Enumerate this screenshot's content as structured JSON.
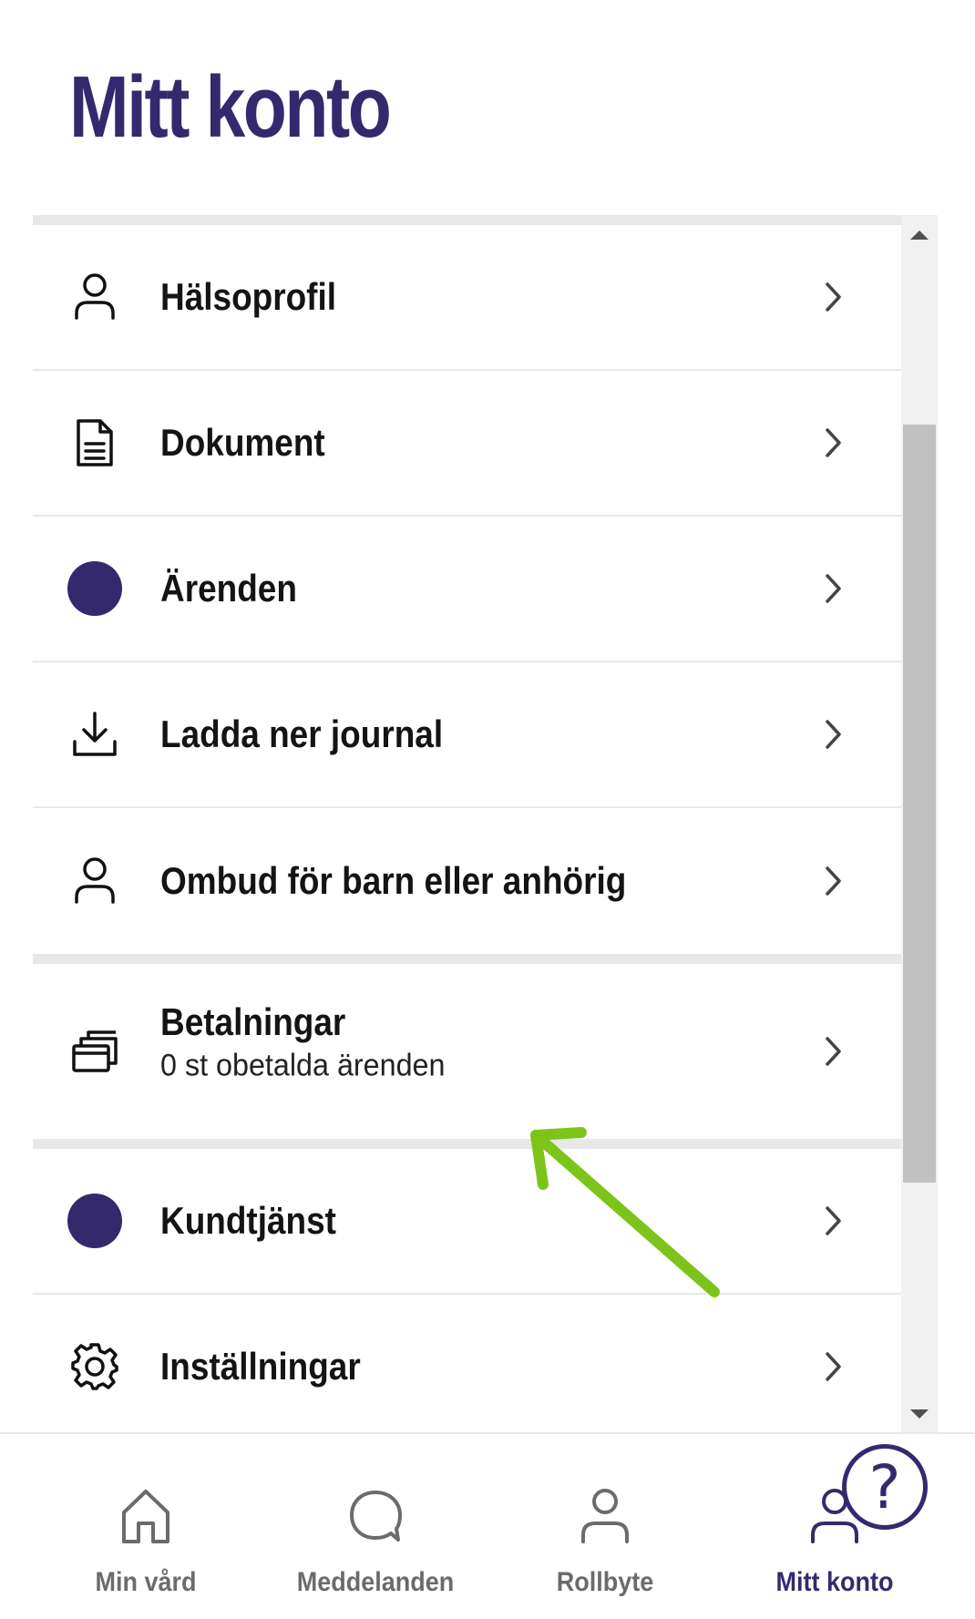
{
  "page": {
    "title": "Mitt konto"
  },
  "menu": {
    "items": [
      {
        "label": "Hälsoprofil",
        "icon": "person-icon"
      },
      {
        "label": "Dokument",
        "icon": "document-icon"
      },
      {
        "label": "Ärenden",
        "icon": "dot-icon"
      },
      {
        "label": "Ladda ner journal",
        "icon": "download-icon"
      },
      {
        "label": "Ombud för barn eller anhörig",
        "icon": "person-icon"
      },
      {
        "label": "Betalningar",
        "sublabel": "0 st obetalda ärenden",
        "icon": "cards-icon"
      },
      {
        "label": "Kundtjänst",
        "icon": "dot-icon"
      },
      {
        "label": "Inställningar",
        "icon": "gear-icon"
      }
    ]
  },
  "bottom_nav": {
    "items": [
      {
        "label": "Min vård",
        "icon": "home-icon",
        "active": false
      },
      {
        "label": "Meddelanden",
        "icon": "chat-icon",
        "active": false
      },
      {
        "label": "Rollbyte",
        "icon": "person-icon",
        "active": false
      },
      {
        "label": "Mitt konto",
        "icon": "person-icon",
        "active": true
      }
    ]
  },
  "help": {
    "label": "?"
  },
  "colors": {
    "brand": "#35296e",
    "annotation_arrow": "#7dc41a",
    "separator": "#e8e8e8"
  }
}
